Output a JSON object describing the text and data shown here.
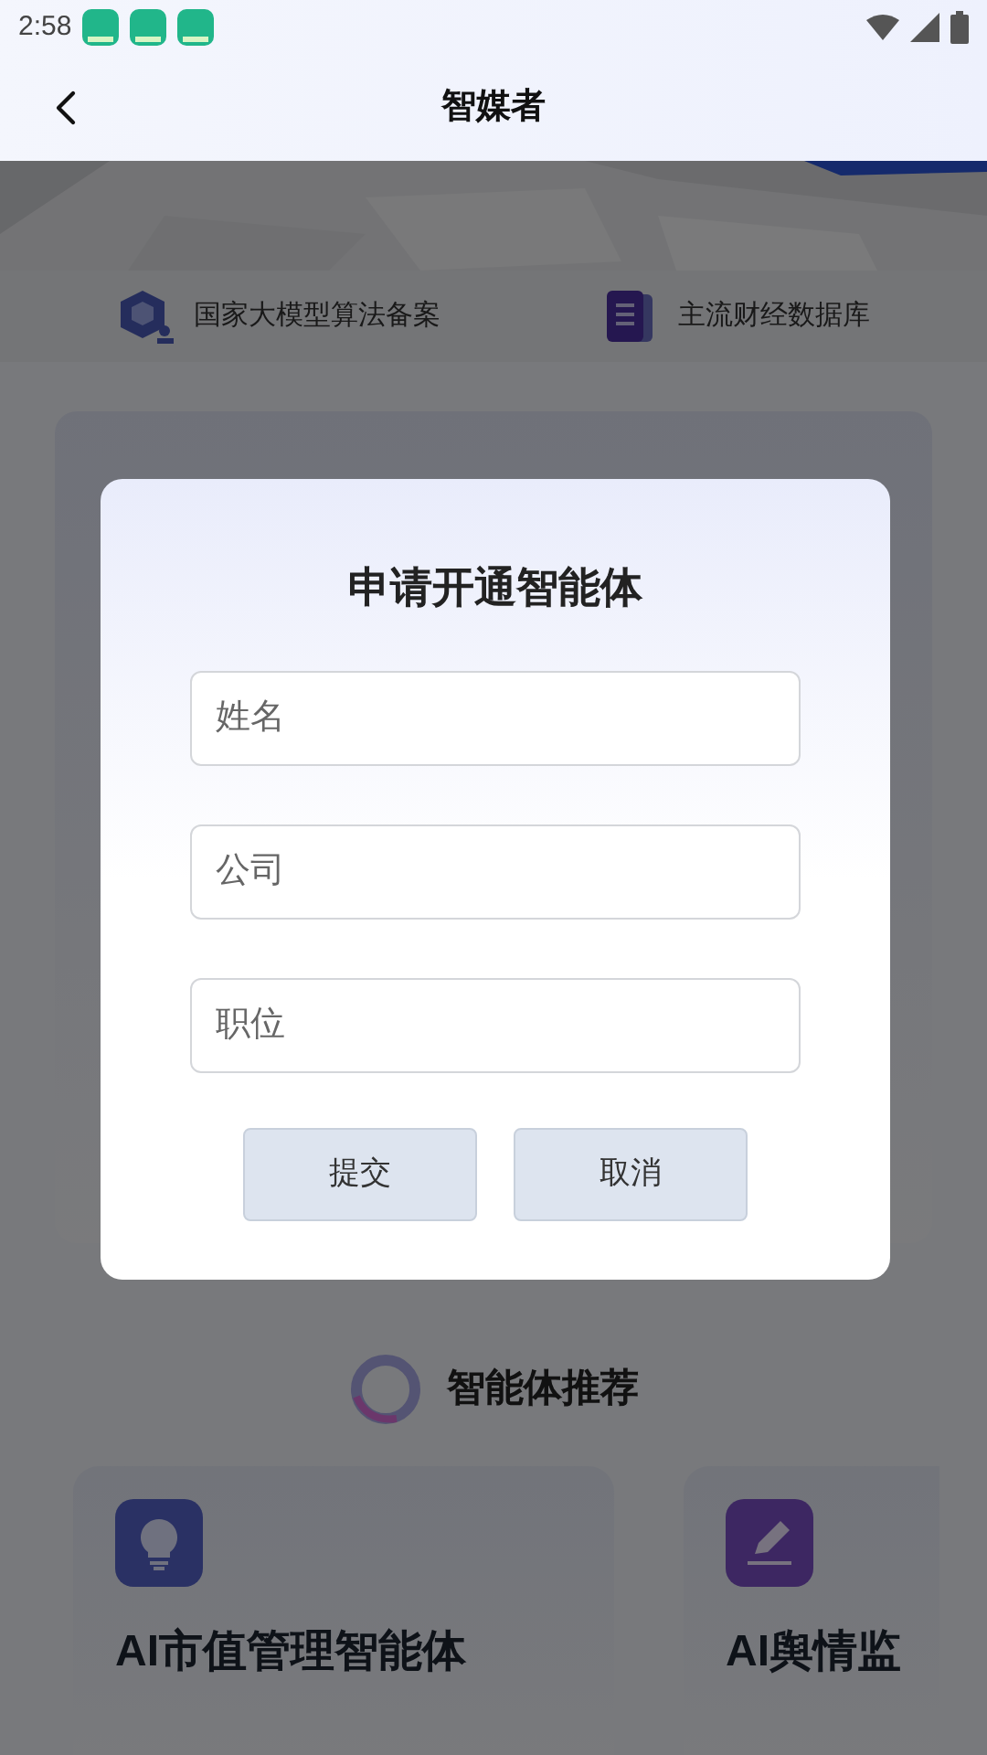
{
  "status_bar": {
    "time": "2:58",
    "notifications": [
      {
        "kind": "app"
      },
      {
        "kind": "app"
      },
      {
        "kind": "app"
      }
    ]
  },
  "header": {
    "title": "智媒者"
  },
  "features": [
    {
      "label": "国家大模型算法备案",
      "kind": "cube"
    },
    {
      "label": "主流财经数据库",
      "kind": "doc"
    }
  ],
  "section": {
    "title": "智能体推荐"
  },
  "agents": [
    {
      "title": "AI市值管理智能体",
      "kind": "bulb"
    },
    {
      "title": "AI舆情监",
      "kind": "pen"
    }
  ],
  "dialog": {
    "title": "申请开通智能体",
    "fields": [
      {
        "placeholder": "姓名"
      },
      {
        "placeholder": "公司"
      },
      {
        "placeholder": "职位"
      }
    ],
    "buttons": [
      "提交",
      "取消"
    ]
  }
}
